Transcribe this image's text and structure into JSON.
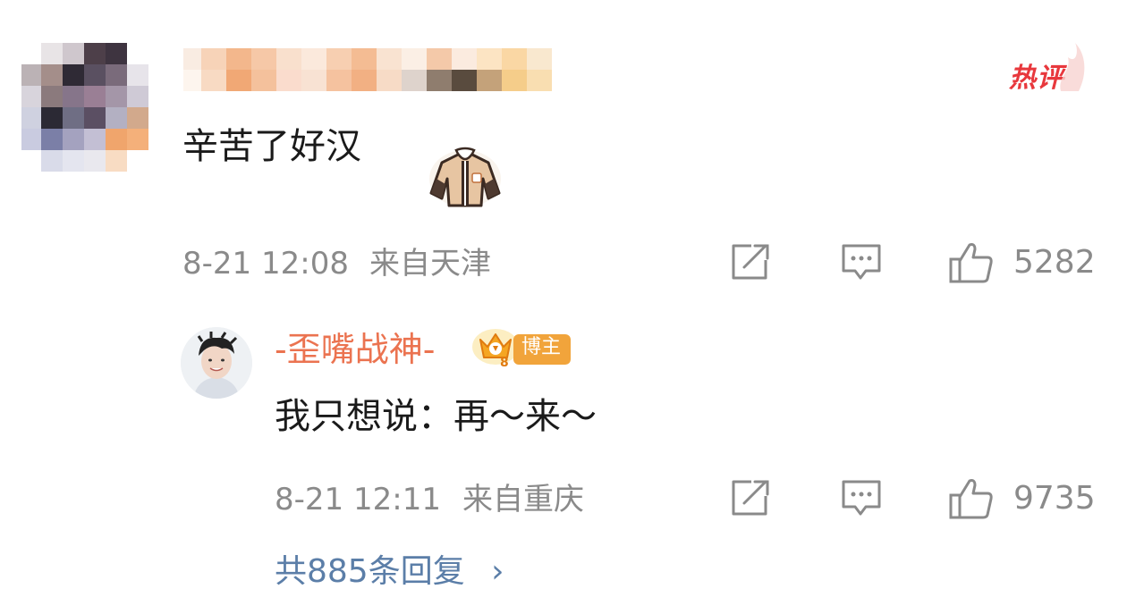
{
  "hot_comment": {
    "badge_label": "热评",
    "text": "辛苦了好汉",
    "timestamp": "8-21 12:08",
    "location": "来自天津",
    "like_count": "5282",
    "sticker_icon": "jacket-sticker-icon"
  },
  "reply": {
    "username": "-歪嘴战神-",
    "badge_label": "博主",
    "text": "我只想说：再～来～",
    "timestamp": "8-21 12:11",
    "location": "来自重庆",
    "like_count": "9735"
  },
  "more_replies": {
    "label": "共885条回复",
    "chevron": "›"
  },
  "colors": {
    "accent_orange": "#eb7350",
    "hot_red": "#e8383d",
    "link_blue": "#5b7ea8",
    "meta_gray": "#8a8a8a"
  }
}
